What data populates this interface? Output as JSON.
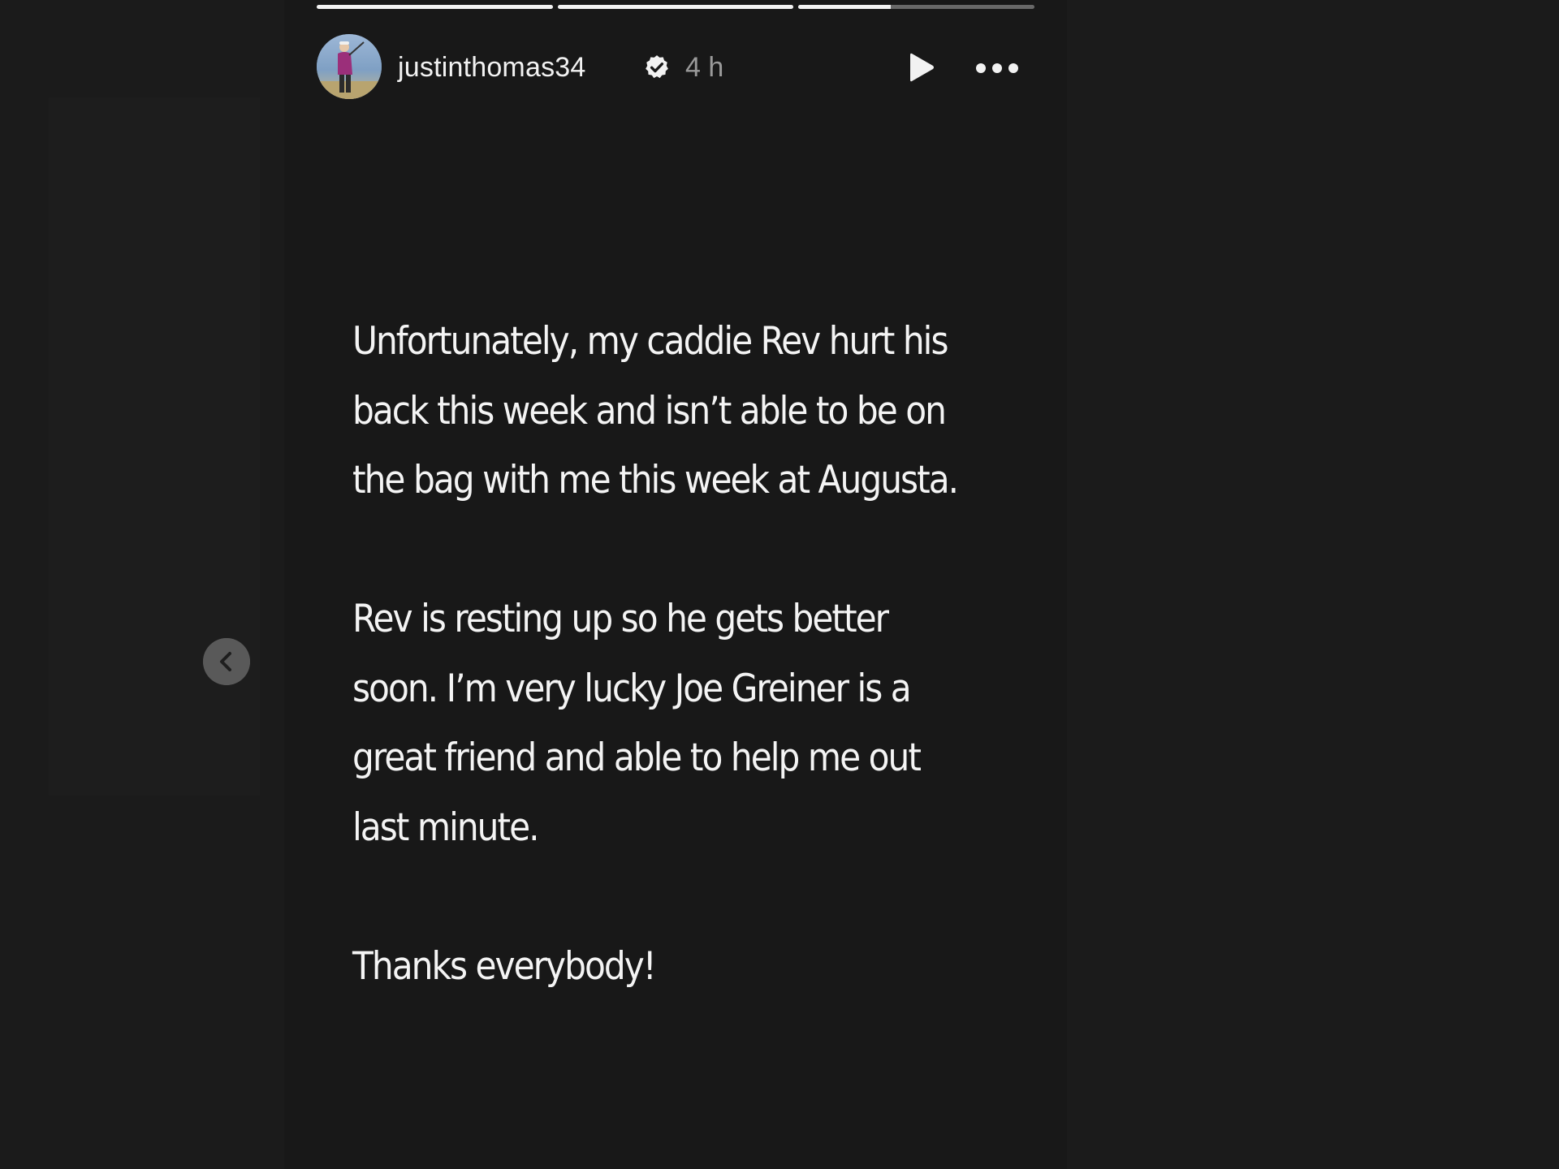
{
  "story": {
    "username": "justinthomas34",
    "verified_icon": "verified-badge-icon",
    "time_ago": "4 h",
    "progress_segments": [
      1.0,
      1.0,
      0.39
    ],
    "body_paragraphs": [
      "Unfortunately, my caddie Rev hurt his back this week and isn’t able to be on the bag with me this week at Augusta.",
      "Rev is resting up so he gets better soon. I’m very lucky Joe Greiner is a great friend and able to help me out last minute.",
      "Thanks everybody!"
    ],
    "colors": {
      "background": "#1b1b1b",
      "story_background": "#181818",
      "text": "#f4f4f4",
      "muted": "#9a9a9a"
    }
  },
  "controls": {
    "play_icon": "play-icon",
    "more_icon": "more-options-icon",
    "prev_icon": "chevron-left-icon"
  }
}
